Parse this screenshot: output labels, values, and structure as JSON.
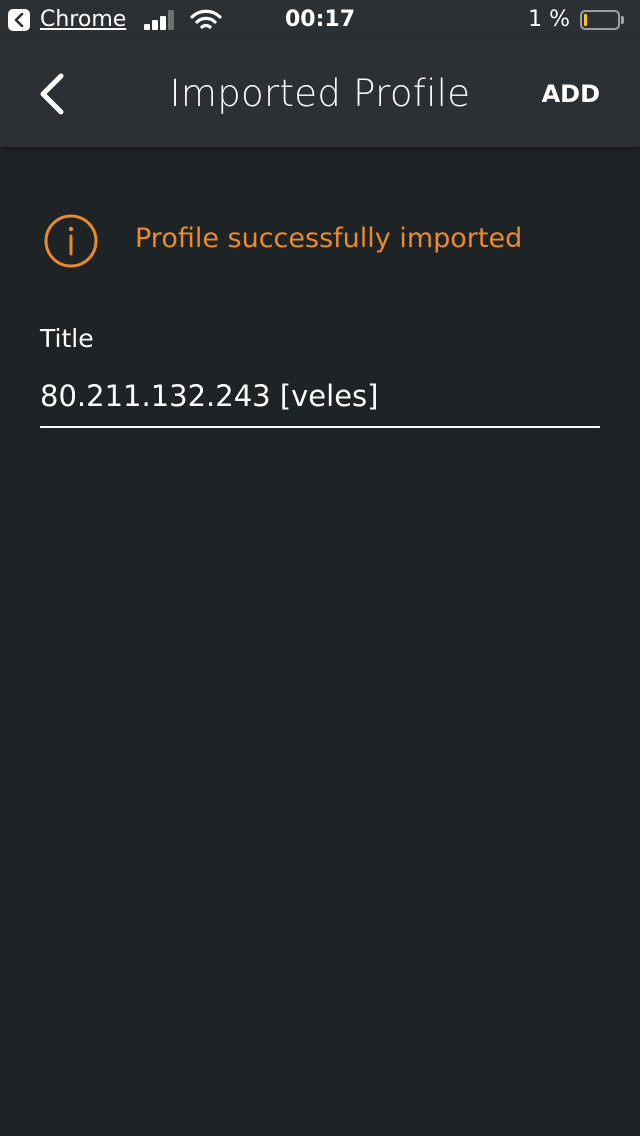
{
  "status_bar": {
    "back_app": "Chrome",
    "time": "00:17",
    "battery": "1 %",
    "battery_level": 0.01,
    "icons": [
      "back-to-app-icon",
      "signal-icon",
      "wifi-icon",
      "battery-icon"
    ]
  },
  "nav": {
    "title": "Imported Profile",
    "add_label": "ADD",
    "back_icon": "chevron-left-icon"
  },
  "notice": {
    "text": "Profile successfully imported",
    "icon": "info-icon",
    "color": "#e98a2d"
  },
  "form": {
    "title_label": "Title",
    "title_value": "80.211.132.243 [veles]"
  },
  "colors": {
    "background": "#1e2326",
    "header": "#2a3033",
    "accent": "#e98a2d",
    "text": "#ffffff"
  }
}
